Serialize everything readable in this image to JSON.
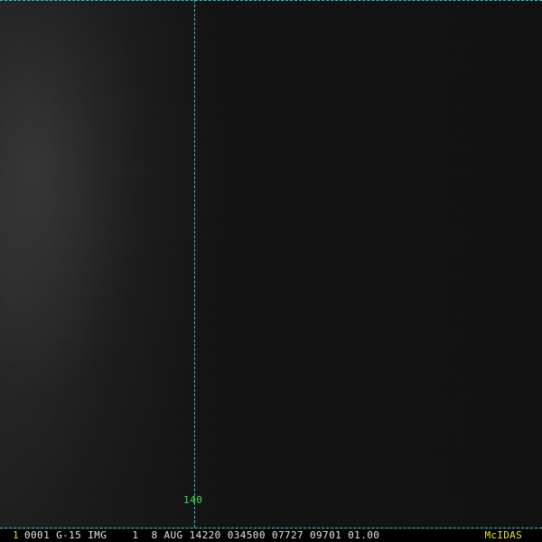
{
  "image": {
    "frame_number": "1",
    "status_line": "0001 G-15 IMG    1  8 AUG 14220 034500 07727 09701 01.00",
    "software": "McIDAS"
  },
  "grid": {
    "longitude_label": "140",
    "line_color": "#22c8d8",
    "label_color": "#3ee04a"
  },
  "colors": {
    "frame_number": "#e8d838",
    "software_label": "#e8e820",
    "status_text": "#e6e6e6"
  }
}
